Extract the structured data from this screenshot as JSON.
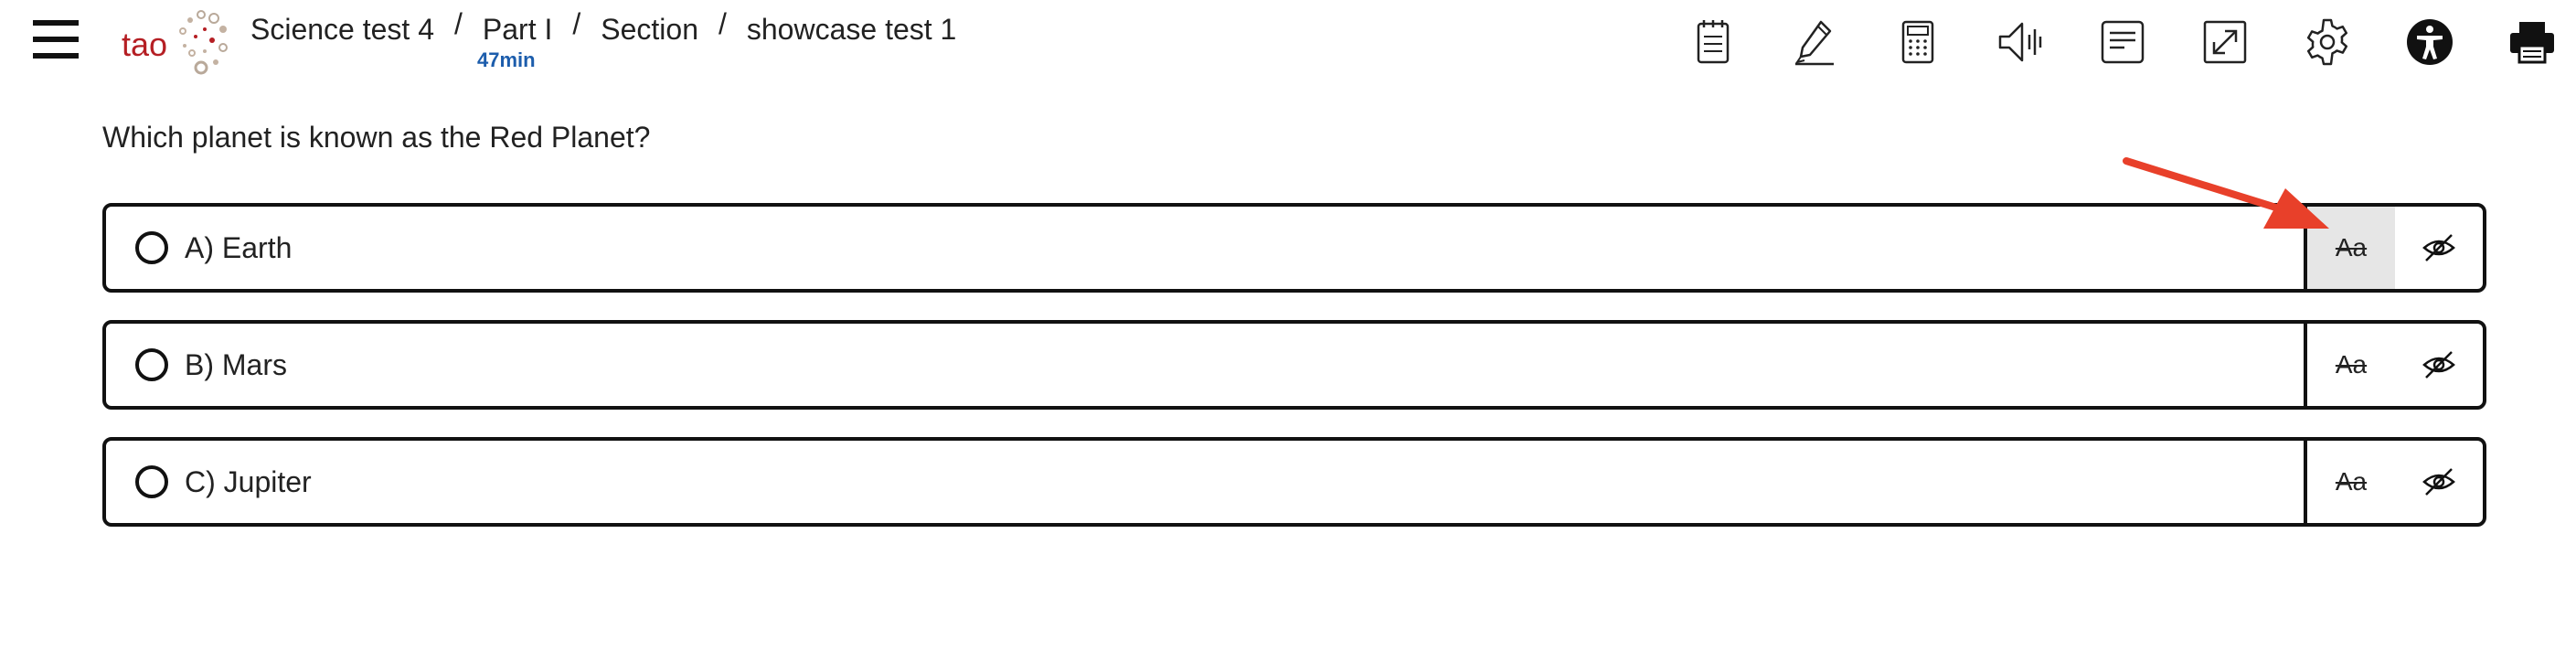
{
  "header": {
    "breadcrumb": [
      "Science test 4",
      "Part I",
      "Section",
      "showcase test 1"
    ],
    "separator": "/",
    "timer": "47min",
    "logo_text": "tao"
  },
  "toolbar": {
    "tools": [
      {
        "icon": "notepad-icon"
      },
      {
        "icon": "highlighter-icon"
      },
      {
        "icon": "calculator-icon"
      },
      {
        "icon": "text-to-speech-icon"
      },
      {
        "icon": "line-reader-icon"
      },
      {
        "icon": "fullscreen-icon"
      },
      {
        "icon": "settings-gear-icon"
      },
      {
        "icon": "accessibility-icon"
      },
      {
        "icon": "print-icon"
      }
    ]
  },
  "question": {
    "prompt": "Which planet is known as the Red Planet?",
    "choices": [
      {
        "label": "A) Earth",
        "strike_label": "Aa",
        "strike_active": true
      },
      {
        "label": "B) Mars",
        "strike_label": "Aa",
        "strike_active": false
      },
      {
        "label": "C) Jupiter",
        "strike_label": "Aa",
        "strike_active": false
      }
    ]
  },
  "colors": {
    "logo_red": "#b51f24",
    "timer_blue": "#1c5dac",
    "arrow_red": "#e8402a",
    "border": "#111111",
    "active_bg": "#e6e6e6"
  }
}
